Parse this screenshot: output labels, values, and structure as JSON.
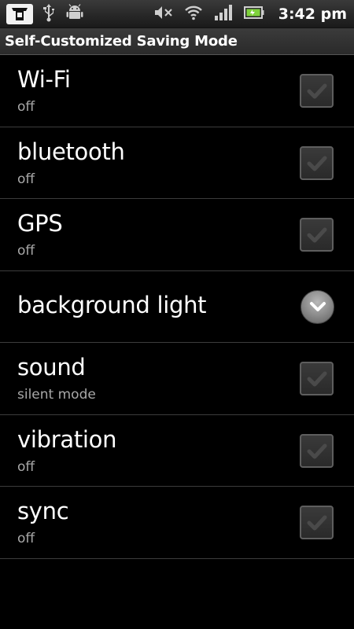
{
  "status_bar": {
    "time": "3:42 pm",
    "icons": [
      "app-icon",
      "usb-icon",
      "android-debug-icon",
      "mute-icon",
      "wifi-icon",
      "signal-icon",
      "battery-icon"
    ]
  },
  "title": "Self-Customized Saving Mode",
  "items": [
    {
      "label": "Wi-Fi",
      "sub": "off",
      "control": "checkbox"
    },
    {
      "label": "bluetooth",
      "sub": "off",
      "control": "checkbox"
    },
    {
      "label": "GPS",
      "sub": "off",
      "control": "checkbox"
    },
    {
      "label": "background light",
      "sub": "",
      "control": "expand"
    },
    {
      "label": "sound",
      "sub": "silent mode",
      "control": "checkbox"
    },
    {
      "label": "vibration",
      "sub": "off",
      "control": "checkbox"
    },
    {
      "label": "sync",
      "sub": "off",
      "control": "checkbox"
    }
  ]
}
